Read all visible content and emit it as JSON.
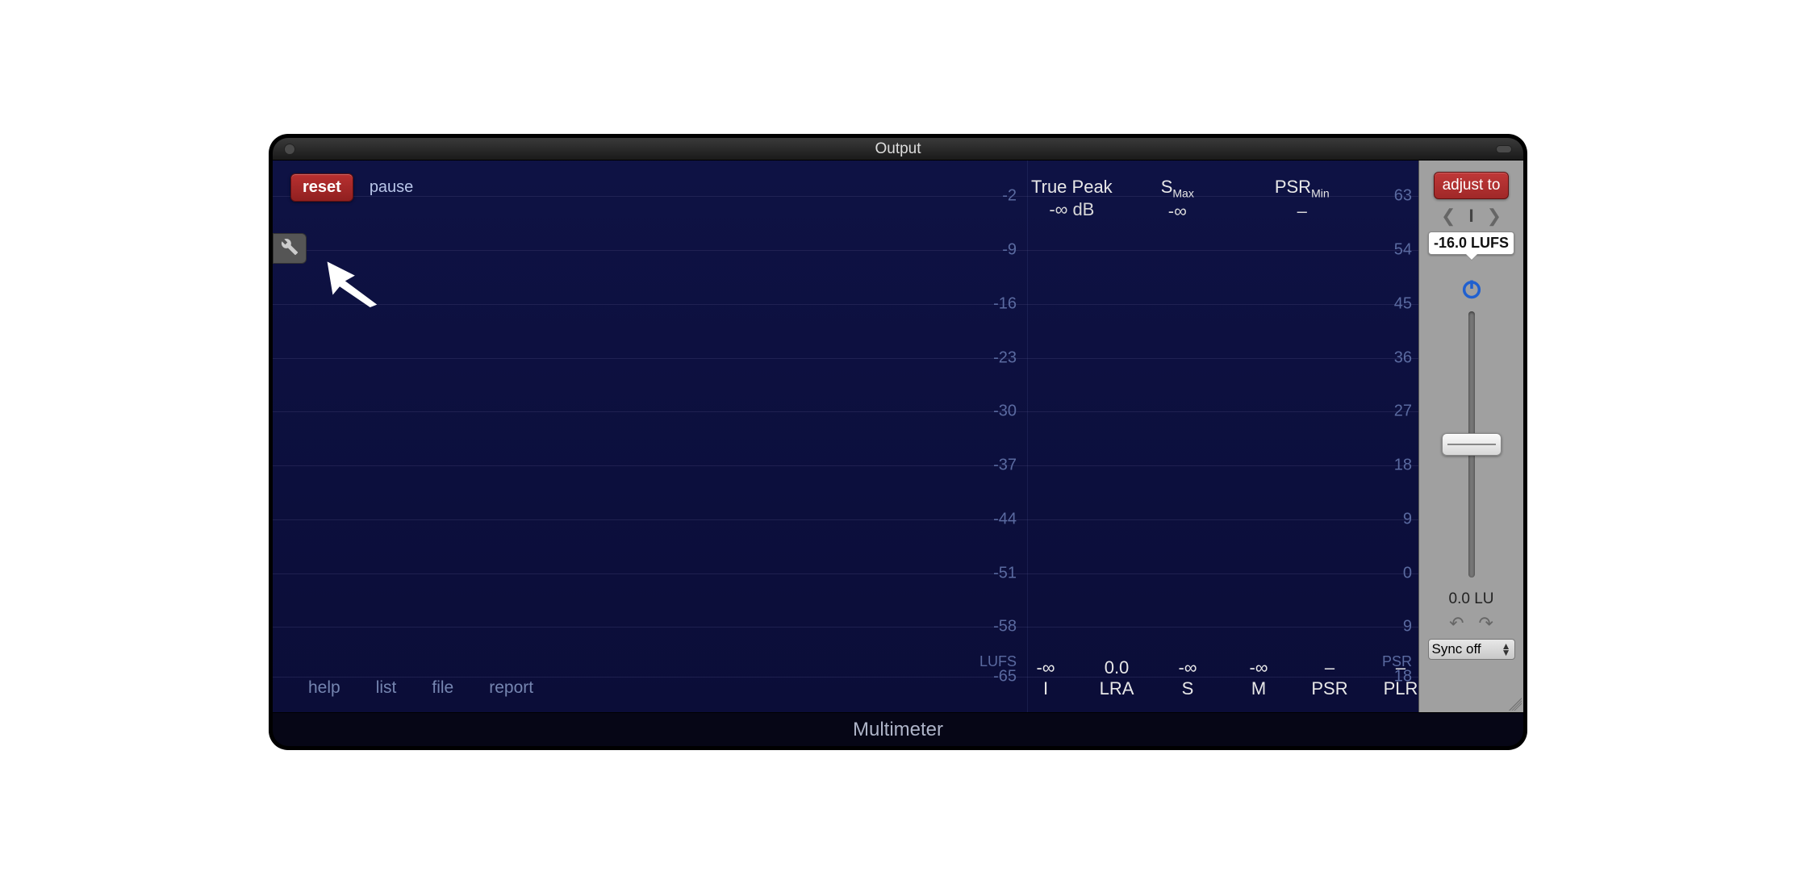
{
  "window": {
    "title": "Output",
    "plugin_name": "Multimeter"
  },
  "toolbar": {
    "reset_label": "reset",
    "pause_label": "pause"
  },
  "lufs_scale": {
    "unit": "LUFS",
    "ticks": [
      {
        "v": "-2",
        "pct": 6.5
      },
      {
        "v": "-9",
        "pct": 16.2
      },
      {
        "v": "-16",
        "pct": 26.0
      },
      {
        "v": "-23",
        "pct": 35.8
      },
      {
        "v": "-30",
        "pct": 45.5
      },
      {
        "v": "-37",
        "pct": 55.3
      },
      {
        "v": "-44",
        "pct": 65.0
      },
      {
        "v": "-51",
        "pct": 74.8
      },
      {
        "v": "-58",
        "pct": 84.5
      },
      {
        "v": "-65",
        "pct": 93.5
      }
    ]
  },
  "psr_scale": {
    "unit": "PSR",
    "ticks": [
      {
        "v": "63",
        "pct": 6.5
      },
      {
        "v": "54",
        "pct": 16.2
      },
      {
        "v": "45",
        "pct": 26.0
      },
      {
        "v": "36",
        "pct": 35.8
      },
      {
        "v": "27",
        "pct": 45.5
      },
      {
        "v": "18",
        "pct": 55.3
      },
      {
        "v": "9",
        "pct": 65.0
      },
      {
        "v": "0",
        "pct": 74.8
      },
      {
        "v": "9",
        "pct": 84.5
      },
      {
        "v": "18",
        "pct": 93.5
      }
    ]
  },
  "top_readouts": {
    "true_peak": {
      "label": "True Peak",
      "value": "-∞ dB"
    },
    "s_max": {
      "label": "S",
      "sub": "Max",
      "value": "-∞"
    },
    "psr_min": {
      "label": "PSR",
      "sub": "Min",
      "value": "–"
    }
  },
  "bottom_readouts": [
    {
      "value": "-∞",
      "label": "I"
    },
    {
      "value": "0.0",
      "label": "LRA"
    },
    {
      "value": "-∞",
      "label": "S"
    },
    {
      "value": "-∞",
      "label": "M"
    },
    {
      "value": "–",
      "label": "PSR"
    },
    {
      "value": "–",
      "label": "PLR"
    }
  ],
  "footer": {
    "help": "help",
    "list": "list",
    "file": "file",
    "report": "report"
  },
  "side": {
    "adjust_label": "adjust to",
    "mode_label": "I",
    "target_lufs": "-16.0 LUFS",
    "gain_readout": "0.0 LU",
    "sync_label": "Sync off"
  }
}
